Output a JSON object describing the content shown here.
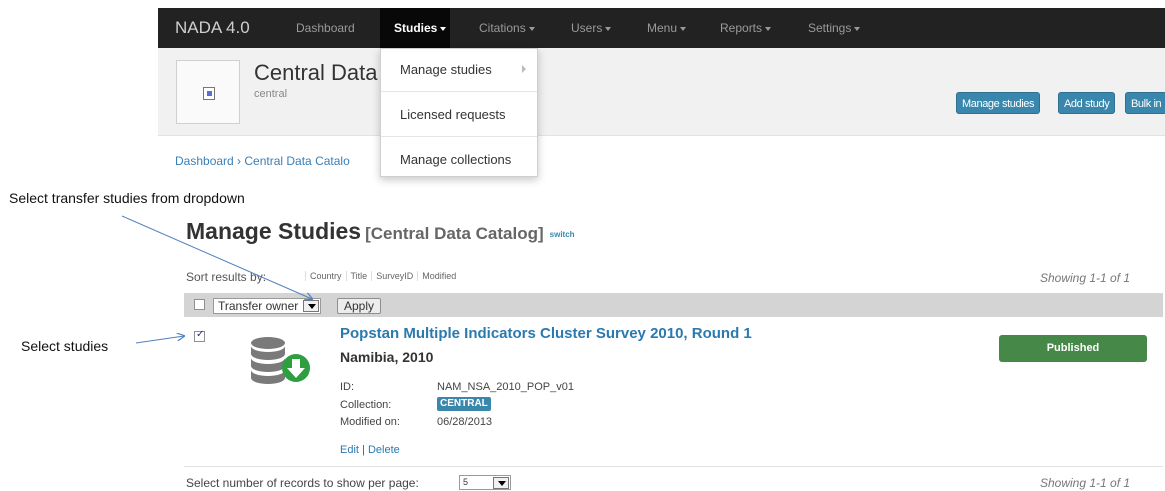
{
  "navbar": {
    "brand": "NADA 4.0",
    "items": [
      {
        "label": "Dashboard",
        "has_caret": false
      },
      {
        "label": "Studies",
        "has_caret": true,
        "active": true
      },
      {
        "label": "Citations",
        "has_caret": true
      },
      {
        "label": "Users",
        "has_caret": true
      },
      {
        "label": "Menu",
        "has_caret": true
      },
      {
        "label": "Reports",
        "has_caret": true
      },
      {
        "label": "Settings",
        "has_caret": true
      }
    ]
  },
  "studies_menu": {
    "items": [
      "Manage studies",
      "Licensed requests",
      "Manage collections"
    ]
  },
  "header": {
    "catalog_title": "Central Data",
    "catalog_subtitle": "central",
    "buttons": [
      "Manage studies",
      "Add study",
      "Bulk in"
    ]
  },
  "breadcrumb": "Dashboard › Central Data Catalo",
  "annotations": {
    "transfer": "Select transfer studies from dropdown",
    "select": "Select studies"
  },
  "page": {
    "title": "Manage Studies",
    "catalog": "[Central Data Catalog]",
    "switch": "switch"
  },
  "sort": {
    "label": "Sort results by:",
    "options": [
      "Country",
      "Title",
      "SurveyID",
      "Modified"
    ],
    "showing": "Showing 1-1 of 1"
  },
  "bulk_action": {
    "selected": "Transfer owner",
    "apply": "Apply"
  },
  "study": {
    "checked": true,
    "title": "Popstan Multiple Indicators Cluster Survey 2010, Round 1",
    "country_year": "Namibia, 2010",
    "id_label": "ID:",
    "id_value": "NAM_NSA_2010_POP_v01",
    "collection_label": "Collection:",
    "collection_value": "CENTRAL",
    "modified_label": "Modified on:",
    "modified_value": "06/28/2013",
    "edit": "Edit",
    "delete": "Delete",
    "status": "Published",
    "icon": "database-download-icon"
  },
  "footer": {
    "per_page_label": "Select number of records to show per page:",
    "per_page_value": "5",
    "showing": "Showing 1-1 of 1"
  },
  "colors": {
    "navbar": "#222222",
    "link": "#2a7ab0",
    "info_button": "#3a87ad",
    "published": "#468847"
  }
}
